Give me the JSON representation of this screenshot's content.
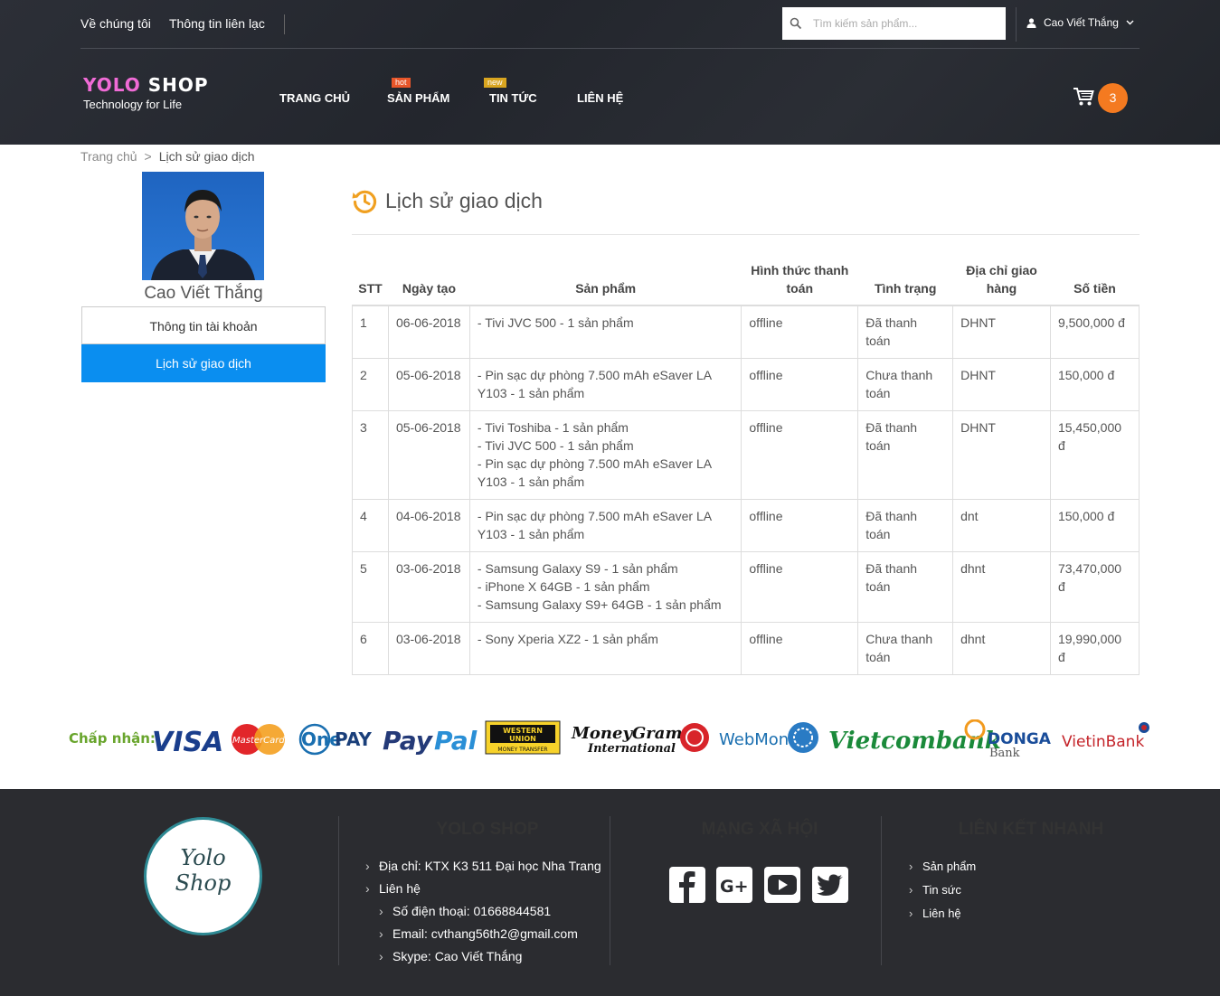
{
  "topbar": {
    "about": "Về chúng tôi",
    "contact": "Thông tin liên lạc",
    "search_placeholder": "Tìm kiếm sản phẩm...",
    "user": "Cao Viết Thắng"
  },
  "logo": {
    "line1a": "YOLO",
    "line1b": "SHOP",
    "tagline": "Technology for Life"
  },
  "nav": {
    "home": "TRANG CHỦ",
    "products": "SẢN PHẨM",
    "products_badge": "hot",
    "news": "TIN TỨC",
    "news_badge": "new",
    "contact": "LIÊN HỆ"
  },
  "cart": {
    "count": "3"
  },
  "breadcrumb": {
    "home": "Trang chủ",
    "sep": ">",
    "current": "Lịch sử giao dịch"
  },
  "sidebar": {
    "name": "Cao Viết Thắng",
    "account_info": "Thông tin tài khoản",
    "history": "Lịch sử giao dịch"
  },
  "page": {
    "title": "Lịch sử giao dịch"
  },
  "table": {
    "headers": [
      "STT",
      "Ngày tạo",
      "Sản phẩm",
      "Hình thức thanh toán",
      "Tình trạng",
      "Địa chỉ giao hàng",
      "Số tiền"
    ],
    "rows": [
      {
        "stt": "1",
        "date": "06-06-2018",
        "products": [
          "- Tivi JVC 500 - 1 sản phẩm"
        ],
        "payment": "offline",
        "status": "Đã thanh toán",
        "address": "DHNT",
        "amount": "9,500,000 đ"
      },
      {
        "stt": "2",
        "date": "05-06-2018",
        "products": [
          "- Pin sạc dự phòng 7.500 mAh eSaver LA Y103 - 1 sản phẩm"
        ],
        "payment": "offline",
        "status": "Chưa thanh toán",
        "address": "DHNT",
        "amount": "150,000 đ"
      },
      {
        "stt": "3",
        "date": "05-06-2018",
        "products": [
          "- Tivi Toshiba - 1 sản phẩm",
          "- Tivi JVC 500 - 1 sản phẩm",
          "- Pin sạc dự phòng 7.500 mAh eSaver LA Y103 - 1 sản phẩm"
        ],
        "payment": "offline",
        "status": "Đã thanh toán",
        "address": "DHNT",
        "amount": "15,450,000 đ"
      },
      {
        "stt": "4",
        "date": "04-06-2018",
        "products": [
          "- Pin sạc dự phòng 7.500 mAh eSaver LA Y103 - 1 sản phẩm"
        ],
        "payment": "offline",
        "status": "Đã thanh toán",
        "address": "dnt",
        "amount": "150,000 đ"
      },
      {
        "stt": "5",
        "date": "03-06-2018",
        "products": [
          "- Samsung Galaxy S9 - 1 sản phẩm",
          "- iPhone X 64GB - 1 sản phẩm",
          "- Samsung Galaxy S9+ 64GB - 1 sản phẩm"
        ],
        "payment": "offline",
        "status": "Đã thanh toán",
        "address": "dhnt",
        "amount": "73,470,000 đ"
      },
      {
        "stt": "6",
        "date": "03-06-2018",
        "products": [
          "- Sony Xperia XZ2 - 1 sản phẩm"
        ],
        "payment": "offline",
        "status": "Chưa thanh toán",
        "address": "dhnt",
        "amount": "19,990,000 đ"
      }
    ]
  },
  "payments": {
    "accept": "Chấp nhận:",
    "visa": "VISA",
    "mastercard": "MasterCard",
    "onepay_a": "One",
    "onepay_b": "PAY",
    "paypal_a": "Pay",
    "paypal_b": "Pal",
    "wu1": "WESTERN",
    "wu2": "UNION",
    "wu3": "MONEY TRANSFER",
    "mg1": "MoneyGram",
    "mg2": "International",
    "webmoney": "WebMoney",
    "vietcombank": "Vietcombank",
    "donga1": "DONGA",
    "donga2": "Bank",
    "vietinbank": "VietinBank"
  },
  "footer": {
    "logo1": "Yolo",
    "logo2": "Shop",
    "shop_title": "YOLO SHOP",
    "address": "Địa chỉ: KTX K3 511 Đại học Nha Trang",
    "contact": "Liên hệ",
    "phone": "Số điện thoại: 01668844581",
    "email": "Email: cvthang56th2@gmail.com",
    "skype": "Skype: Cao Viết Thắng",
    "social_title": "MẠNG XÃ HỘI",
    "links_title": "LIÊN KẾT NHANH",
    "links": [
      "Sản phẩm",
      "Tin sức",
      "Liên hệ"
    ]
  },
  "colors": {
    "header_bg": "#2c2f37",
    "accent_blue": "#0a8ef0",
    "cart_badge": "#f47a20",
    "footer_bg": "#2b2c30",
    "history_icon": "#f0a020"
  },
  "icons": {
    "search": "search-icon",
    "user": "user-icon",
    "chevron": "chevron-down-icon",
    "cart": "cart-icon",
    "history": "history-clock-icon",
    "facebook": "facebook-icon",
    "google": "google-plus-icon",
    "youtube": "youtube-icon",
    "twitter": "twitter-icon"
  }
}
